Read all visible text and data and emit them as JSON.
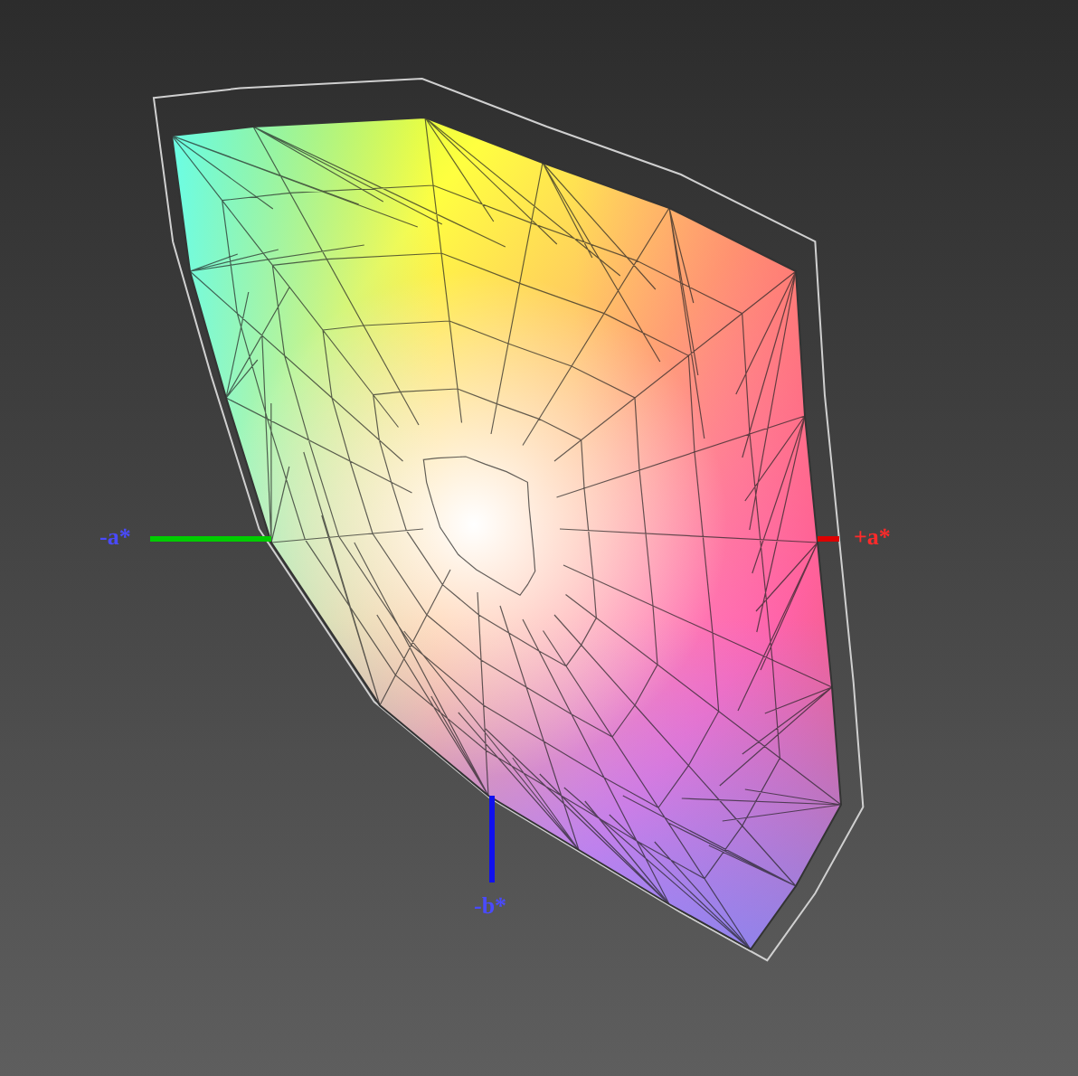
{
  "axes": [
    {
      "line": {
        "color": "#00cc00"
      },
      "label": {
        "text": "-a*",
        "color": "#4a4aff"
      }
    },
    {
      "line": {
        "color": "#dd0000"
      },
      "label": {
        "text": "+a*",
        "color": "#ff2a2a"
      }
    },
    {
      "line": {
        "color": "#1010ee"
      },
      "label": {
        "text": "-b*",
        "color": "#4a4aff"
      }
    }
  ]
}
